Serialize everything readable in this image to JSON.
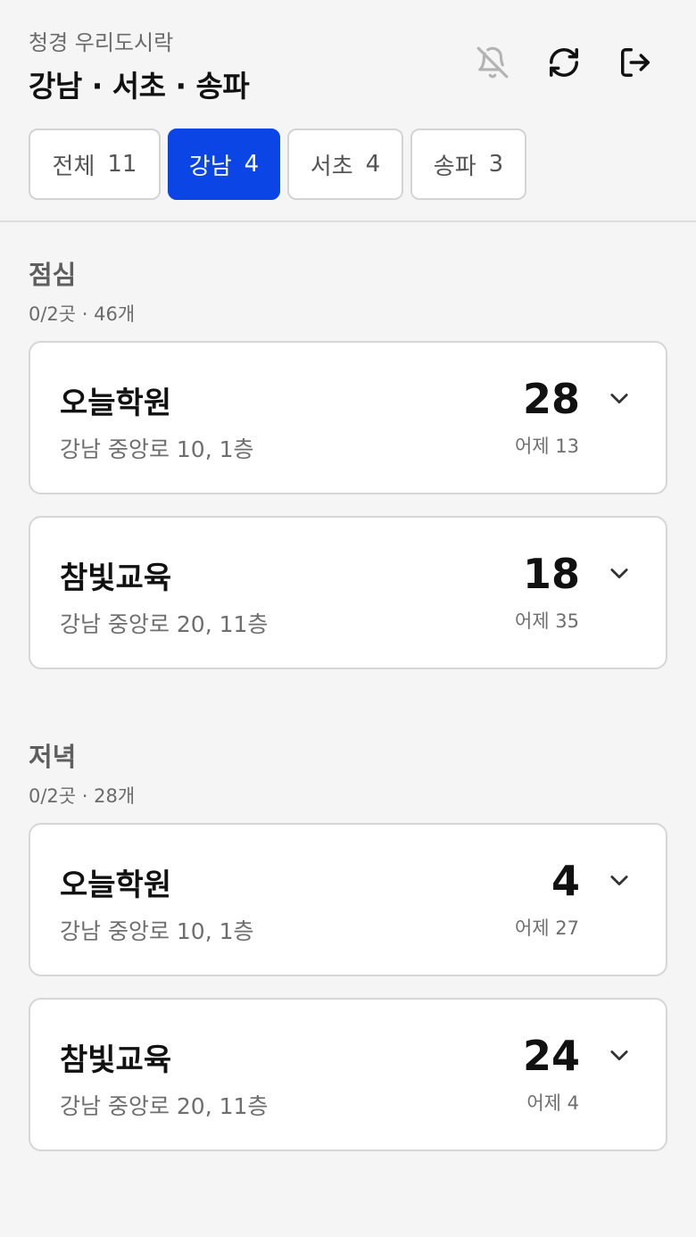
{
  "header": {
    "subtitle": "청경 우리도시락",
    "title": "강남 · 서초 · 송파",
    "icons": [
      "bell-off-icon",
      "refresh-icon",
      "logout-icon"
    ]
  },
  "tabs": [
    {
      "label": "전체",
      "count": "11",
      "active": false
    },
    {
      "label": "강남",
      "count": "4",
      "active": true
    },
    {
      "label": "서초",
      "count": "4",
      "active": false
    },
    {
      "label": "송파",
      "count": "3",
      "active": false
    }
  ],
  "sections": [
    {
      "title": "점심",
      "meta": "0/2곳 · 46개",
      "items": [
        {
          "name": "오늘학원",
          "address": "강남 중앙로 10, 1층",
          "count": "28",
          "yesterday": "어제 13"
        },
        {
          "name": "참빛교육",
          "address": "강남 중앙로 20, 11층",
          "count": "18",
          "yesterday": "어제 35"
        }
      ]
    },
    {
      "title": "저녁",
      "meta": "0/2곳 · 28개",
      "items": [
        {
          "name": "오늘학원",
          "address": "강남 중앙로 10, 1층",
          "count": "4",
          "yesterday": "어제 27"
        },
        {
          "name": "참빛교육",
          "address": "강남 중앙로 20, 11층",
          "count": "24",
          "yesterday": "어제 4"
        }
      ]
    }
  ],
  "colors": {
    "accent": "#0c45e6",
    "background": "#f5f5f5",
    "card": "#ffffff",
    "muted_text": "#6e6e6e"
  }
}
